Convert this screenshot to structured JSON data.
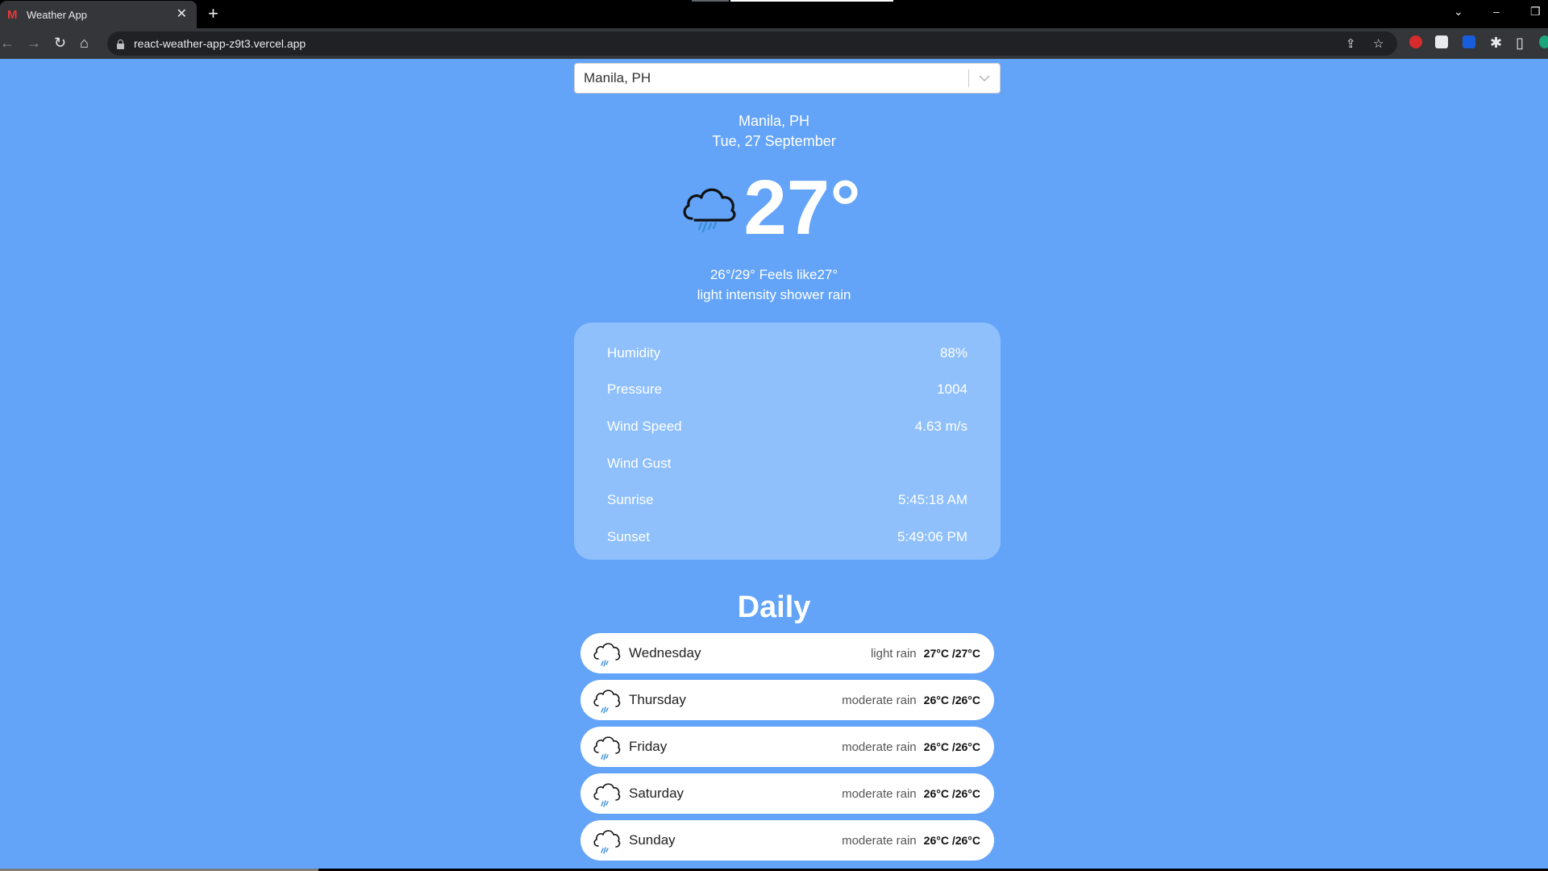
{
  "browser": {
    "tab_title": "Weather App",
    "tab_favicon": "M",
    "url": "react-weather-app-z9t3.vercel.app",
    "icons": [
      "back-icon",
      "forward-icon",
      "reload-icon",
      "home-icon",
      "lock-icon",
      "share-icon",
      "star-icon",
      "extensions-icon",
      "sidepanel-icon",
      "close-icon",
      "new-tab-icon",
      "minimize-icon",
      "restore-icon",
      "chevron-down-icon"
    ]
  },
  "search": {
    "selected": "Manila, PH"
  },
  "current": {
    "city": "Manila, PH",
    "date": "Tue, 27 September",
    "temp": "27°",
    "minmax": "26°/29° Feels like27°",
    "description": "light intensity shower rain",
    "icon": "rain-cloud-icon"
  },
  "details": [
    {
      "label": "Humidity",
      "value": "88%"
    },
    {
      "label": "Pressure",
      "value": "1004"
    },
    {
      "label": "Wind Speed",
      "value": "4.63 m/s"
    },
    {
      "label": "Wind Gust",
      "value": ""
    },
    {
      "label": "Sunrise",
      "value": "5:45:18 AM"
    },
    {
      "label": "Sunset",
      "value": "5:49:06 PM"
    }
  ],
  "daily": {
    "title": "Daily",
    "days": [
      {
        "day": "Wednesday",
        "desc": "light rain",
        "temps": "27°C /27°C"
      },
      {
        "day": "Thursday",
        "desc": "moderate rain",
        "temps": "26°C /26°C"
      },
      {
        "day": "Friday",
        "desc": "moderate rain",
        "temps": "26°C /26°C"
      },
      {
        "day": "Saturday",
        "desc": "moderate rain",
        "temps": "26°C /26°C"
      },
      {
        "day": "Sunday",
        "desc": "moderate rain",
        "temps": "26°C /26°C"
      }
    ]
  },
  "colors": {
    "page_bg": "#63a4f9",
    "details_bg": "#8fc0fb",
    "rain": "#3b8fd6"
  }
}
